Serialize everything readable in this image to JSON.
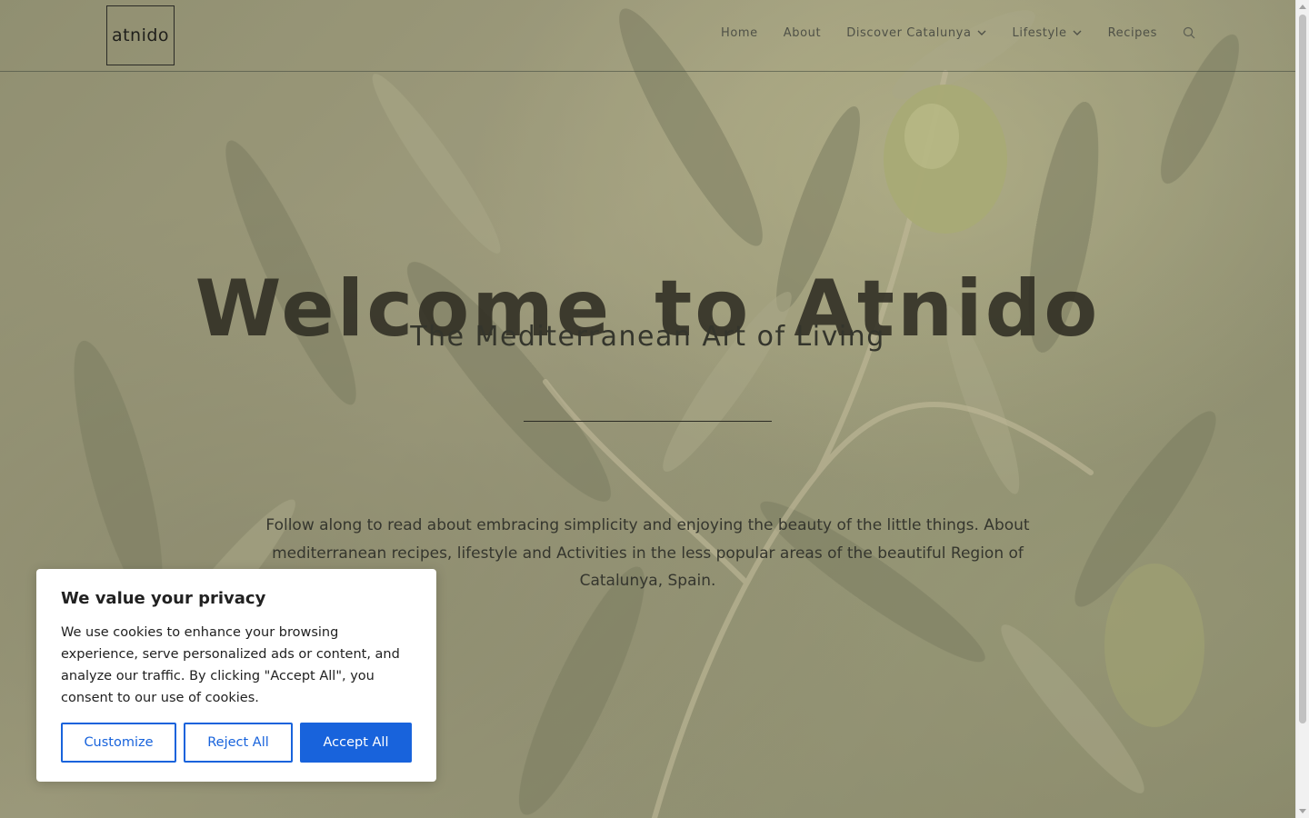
{
  "site": {
    "logo_text": "atnido"
  },
  "nav": {
    "items": [
      {
        "label": "Home",
        "has_dropdown": false
      },
      {
        "label": "About",
        "has_dropdown": false
      },
      {
        "label": "Discover Catalunya",
        "has_dropdown": true
      },
      {
        "label": "Lifestyle",
        "has_dropdown": true
      },
      {
        "label": "Recipes",
        "has_dropdown": false
      }
    ],
    "search_icon": "search-icon",
    "dropdown_icon": "chevron-down-icon"
  },
  "hero": {
    "title": "Welcome to Atnido",
    "subtitle": "The Mediterranean Art of Living",
    "text": "Follow along to read about embracing simplicity and enjoying the beauty of the little things. About mediterranean recipes, lifestyle and Activities in the less popular areas of the beautiful Region of Catalunya, Spain."
  },
  "cookie": {
    "title": "We value your privacy",
    "body": "We use cookies to enhance your browsing experience, serve personalized ads or content, and analyze our traffic. By clicking \"Accept All\", you consent to our use of cookies.",
    "customize_label": "Customize",
    "reject_label": "Reject All",
    "accept_label": "Accept All"
  },
  "colors": {
    "accent": "#1863dc",
    "text_dark": "#212121",
    "hero_text": "#35362e"
  }
}
